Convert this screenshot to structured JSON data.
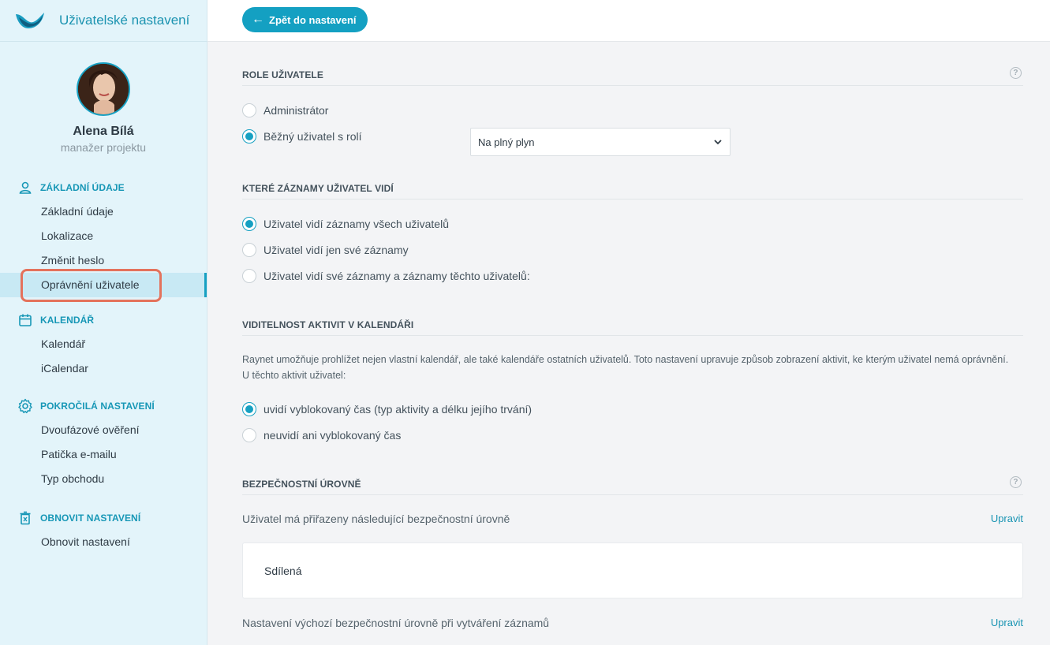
{
  "sidebar": {
    "title": "Uživatelské nastavení",
    "profile": {
      "name": "Alena Bílá",
      "role": "manažer projektu"
    },
    "sections": [
      {
        "label": "ZÁKLADNÍ ÚDAJE",
        "icon": "user-icon",
        "items": [
          "Základní údaje",
          "Lokalizace",
          "Změnit heslo",
          "Oprávnění uživatele"
        ]
      },
      {
        "label": "KALENDÁŘ",
        "icon": "calendar-icon",
        "items": [
          "Kalendář",
          "iCalendar"
        ]
      },
      {
        "label": "POKROČILÁ NASTAVENÍ",
        "icon": "gear-icon",
        "items": [
          "Dvoufázové ověření",
          "Patička e-mailu",
          "Typ obchodu"
        ]
      },
      {
        "label": "OBNOVIT NASTAVENÍ",
        "icon": "trash-icon",
        "items": [
          "Obnovit nastavení"
        ]
      }
    ],
    "active_item": "Oprávnění uživatele"
  },
  "topbar": {
    "back_label": "Zpět do nastavení"
  },
  "roles": {
    "title": "ROLE UŽIVATELE",
    "options": [
      "Administrátor",
      "Běžný uživatel s rolí"
    ],
    "selected": 1,
    "role_select_value": "Na plný plyn"
  },
  "visibility": {
    "title": "KTERÉ ZÁZNAMY UŽIVATEL VIDÍ",
    "options": [
      "Uživatel vidí záznamy všech uživatelů",
      "Uživatel vidí jen své záznamy",
      "Uživatel vidí své záznamy a záznamy těchto uživatelů:"
    ],
    "selected": 0
  },
  "calendar": {
    "title": "VIDITELNOST AKTIVIT V KALENDÁŘI",
    "description": "Raynet umožňuje prohlížet nejen vlastní kalendář, ale také kalendáře ostatních uživatelů. Toto nastavení upravuje způsob zobrazení aktivit, ke kterým uživatel nemá oprávnění. U těchto aktivit uživatel:",
    "options": [
      "uvidí vyblokovaný čas (typ aktivity a délku jejího trvání)",
      "neuvidí ani vyblokovaný čas"
    ],
    "selected": 0
  },
  "security": {
    "title": "BEZPEČNOSTNÍ ÚROVNĚ",
    "assigned_label": "Uživatel má přiřazeny následující bezpečnostní úrovně",
    "edit_label": "Upravit",
    "level": "Sdílená",
    "default_label": "Nastavení výchozí bezpečnostní úrovně při vytváření záznamů",
    "default_edit_label": "Upravit"
  },
  "colors": {
    "accent": "#16a0c2",
    "sidebar_bg": "#e3f4fa",
    "highlight": "#e4725c"
  }
}
